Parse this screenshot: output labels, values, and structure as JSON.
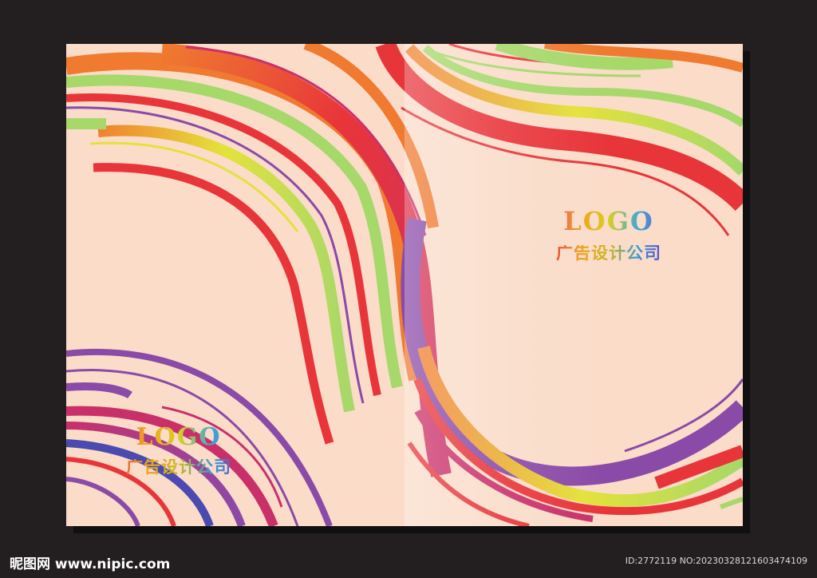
{
  "cover": {
    "front": {
      "logo_text": "LOGO",
      "company_name": "广告设计公司"
    },
    "back": {
      "logo_text": "LOGO",
      "company_name": "广告设计公司"
    }
  },
  "footer": {
    "site_label": "昵图网 www.nipic.com",
    "image_info": "ID:2772119 NO:20230328121603474109"
  },
  "colors": {
    "background": "#231f20",
    "paper": "#fadcc9",
    "stripe_red": "#e8353a",
    "stripe_orange": "#ef7a30",
    "stripe_green": "#a6d86a",
    "stripe_yellow": "#e4e23a",
    "stripe_purple": "#8a4aa8",
    "stripe_magenta": "#c9306a",
    "stripe_blue": "#4a4ab0"
  },
  "icons": {
    "footer_logo": "nipic-logo"
  }
}
